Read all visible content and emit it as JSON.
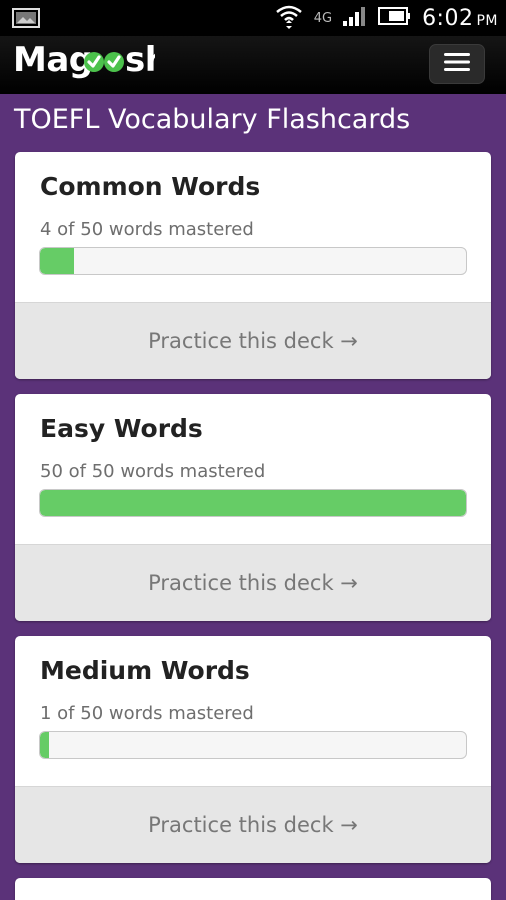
{
  "status_bar": {
    "network": "4G",
    "time": "6:02",
    "ampm": "PM"
  },
  "app": {
    "logo": "Magoosh"
  },
  "page": {
    "title": "TOEFL Vocabulary Flashcards"
  },
  "decks": [
    {
      "name": "Common Words",
      "mastered_text": "4 of 50 words mastered",
      "mastered": 4,
      "total": 50,
      "action": "Practice this deck →"
    },
    {
      "name": "Easy Words",
      "mastered_text": "50 of 50 words mastered",
      "mastered": 50,
      "total": 50,
      "action": "Practice this deck →"
    },
    {
      "name": "Medium Words",
      "mastered_text": "1 of 50 words mastered",
      "mastered": 1,
      "total": 50,
      "action": "Practice this deck →"
    }
  ],
  "colors": {
    "background": "#5b3279",
    "progress_fill": "#66cc66",
    "check_green": "#4cc24c"
  }
}
